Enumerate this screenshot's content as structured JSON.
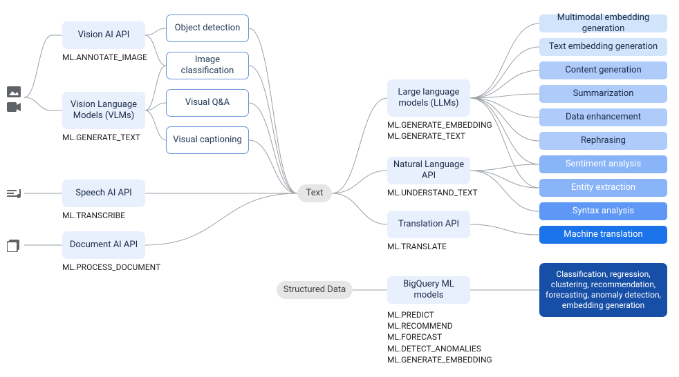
{
  "icons": {
    "image": "image-icon",
    "video": "video-icon",
    "audio": "audio-icon",
    "doc": "document-icon"
  },
  "left": {
    "vision_api": "Vision AI API",
    "vision_fn": "ML.ANNOTATE_IMAGE",
    "vlm": "Vision Language Models (VLMs)",
    "vlm_fn": "ML.GENERATE_TEXT",
    "speech": "Speech AI API",
    "speech_fn": "ML.TRANSCRIBE",
    "doc": "Document AI API",
    "doc_fn": "ML.PROCESS_DOCUMENT"
  },
  "tasks": {
    "obj": "Object detection",
    "cls": "Image classification",
    "vqa": "Visual Q&A",
    "cap": "Visual captioning"
  },
  "hub": {
    "text": "Text",
    "struct": "Structured Data"
  },
  "mid": {
    "llm": "Large language models (LLMs)",
    "llm_fn1": "ML.GENERATE_EMBEDDING",
    "llm_fn2": "ML.GENERATE_TEXT",
    "nl": "Natural Language API",
    "nl_fn": "ML.UNDERSTAND_TEXT",
    "tr": "Translation API",
    "tr_fn": "ML.TRANSLATE",
    "bq": "BigQuery ML models",
    "bq_fn": "ML.PREDICT\nML.RECOMMEND\nML.FORECAST\nML.DETECT_ANOMALIES\nML.GENERATE_EMBEDDING"
  },
  "out": [
    "Multimodal embedding generation",
    "Text embedding generation",
    "Content generation",
    "Summarization",
    "Data enhancement",
    "Rephrasing",
    "Sentiment analysis",
    "Entity extraction",
    "Syntax analysis",
    "Machine translation"
  ],
  "outbig": "Classification, regression, clustering, recommendation, forecasting, anomaly detection, embedding generation"
}
